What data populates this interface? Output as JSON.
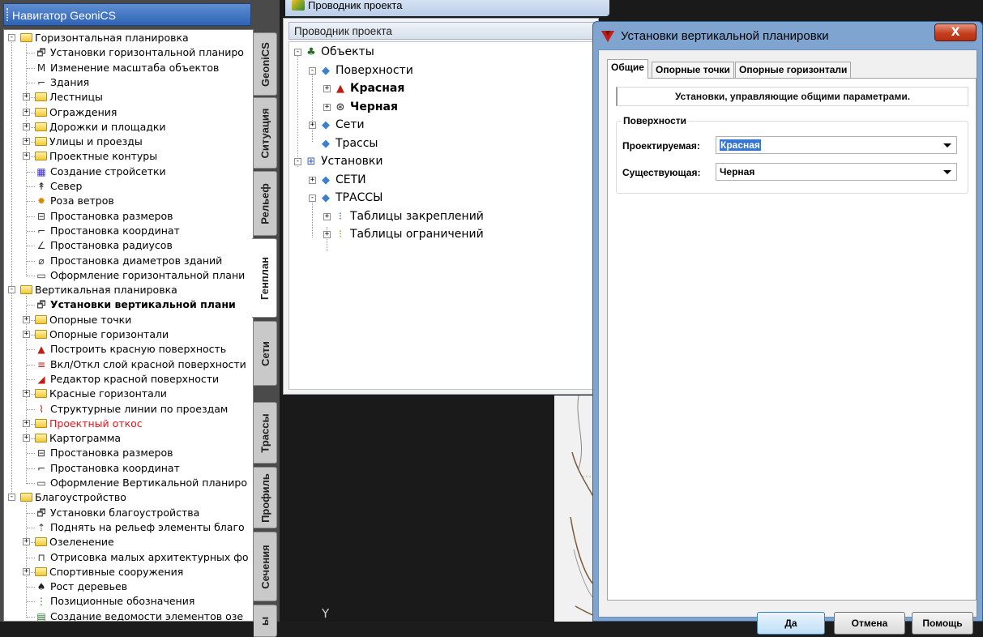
{
  "navigator": {
    "title": "Навигатор GeoniCS",
    "tabs": [
      "GeoniCS",
      "Ситуация",
      "Рельеф",
      "Генплан",
      "Сети",
      "Трассы",
      "Профиль",
      "Сечения",
      "ы"
    ],
    "active_tab": "Генплан",
    "tree": [
      {
        "label": "Горизонтальная планировка",
        "level": 0,
        "icon": "folder-open-icon",
        "expander": "-"
      },
      {
        "label": "Установки горизонтальной планиро",
        "level": 1,
        "icon": "settings-icon"
      },
      {
        "label": "Изменение масштаба объектов",
        "level": 1,
        "icon": "scale-icon"
      },
      {
        "label": "Здания",
        "level": 1,
        "icon": "building-icon"
      },
      {
        "label": "Лестницы",
        "level": 1,
        "icon": "folder-icon",
        "expander": "+"
      },
      {
        "label": "Ограждения",
        "level": 1,
        "icon": "folder-icon",
        "expander": "+"
      },
      {
        "label": "Дорожки и площадки",
        "level": 1,
        "icon": "folder-icon",
        "expander": "+"
      },
      {
        "label": "Улицы и проезды",
        "level": 1,
        "icon": "folder-icon",
        "expander": "+"
      },
      {
        "label": "Проектные контуры",
        "level": 1,
        "icon": "folder-icon",
        "expander": "+"
      },
      {
        "label": "Создание стройсетки",
        "level": 1,
        "icon": "grid-icon"
      },
      {
        "label": "Север",
        "level": 1,
        "icon": "north-icon"
      },
      {
        "label": "Роза ветров",
        "level": 1,
        "icon": "wind-rose-icon"
      },
      {
        "label": "Простановка размеров",
        "level": 1,
        "icon": "dimension-icon"
      },
      {
        "label": "Простановка координат",
        "level": 1,
        "icon": "coordinate-icon"
      },
      {
        "label": "Простановка радиусов",
        "level": 1,
        "icon": "radius-icon"
      },
      {
        "label": "Простановка диаметров зданий",
        "level": 1,
        "icon": "diameter-icon"
      },
      {
        "label": "Оформление горизонтальной плани",
        "level": 1,
        "icon": "document-icon"
      },
      {
        "label": "Вертикальная планировка",
        "level": 0,
        "icon": "folder-open-icon",
        "expander": "-"
      },
      {
        "label": "Установки вертикальной плани",
        "level": 1,
        "icon": "settings-icon",
        "bold": true
      },
      {
        "label": "Опорные точки",
        "level": 1,
        "icon": "folder-icon",
        "expander": "+"
      },
      {
        "label": "Опорные горизонтали",
        "level": 1,
        "icon": "folder-icon",
        "expander": "+"
      },
      {
        "label": "Построить красную поверхность",
        "level": 1,
        "icon": "red-surface-icon"
      },
      {
        "label": "Вкл/Откл слой красной поверхности",
        "level": 1,
        "icon": "layer-toggle-icon"
      },
      {
        "label": "Редактор красной поверхности",
        "level": 1,
        "icon": "surface-editor-icon"
      },
      {
        "label": "Красные горизонтали",
        "level": 1,
        "icon": "folder-icon",
        "expander": "+"
      },
      {
        "label": "Структурные линии по проездам",
        "level": 1,
        "icon": "structure-lines-icon"
      },
      {
        "label": "Проектный откос",
        "level": 1,
        "icon": "folder-icon",
        "expander": "+",
        "red": true
      },
      {
        "label": "Картограмма",
        "level": 1,
        "icon": "folder-icon",
        "expander": "+"
      },
      {
        "label": "Простановка размеров",
        "level": 1,
        "icon": "dimension-icon"
      },
      {
        "label": "Простановка координат",
        "level": 1,
        "icon": "coordinate-icon"
      },
      {
        "label": "Оформление Вертикальной планиро",
        "level": 1,
        "icon": "document-icon"
      },
      {
        "label": "Благоустройство",
        "level": 0,
        "icon": "folder-open-icon",
        "expander": "-"
      },
      {
        "label": "Установки благоустройства",
        "level": 1,
        "icon": "settings-icon"
      },
      {
        "label": "Поднять на рельеф элементы благо",
        "level": 1,
        "icon": "lift-icon"
      },
      {
        "label": "Озеленение",
        "level": 1,
        "icon": "folder-icon",
        "expander": "+"
      },
      {
        "label": "Отрисовка малых архитектурных фо",
        "level": 1,
        "icon": "bench-icon"
      },
      {
        "label": "Спортивные сооружения",
        "level": 1,
        "icon": "folder-icon",
        "expander": "+"
      },
      {
        "label": "Рост деревьев",
        "level": 1,
        "icon": "tree-growth-icon"
      },
      {
        "label": "Позиционные обозначения",
        "level": 1,
        "icon": "position-marks-icon"
      },
      {
        "label": "Создание ведомости элементов озе",
        "level": 1,
        "icon": "table-icon"
      }
    ]
  },
  "explorer": {
    "caption": "Проводник проекта",
    "header": "Проводник проекта",
    "tree": [
      {
        "label": "Объекты",
        "level": 0,
        "icon": "objects-icon",
        "expander": "-"
      },
      {
        "label": "Поверхности",
        "level": 1,
        "icon": "surfaces-icon",
        "expander": "-"
      },
      {
        "label": "Красная",
        "level": 2,
        "icon": "red-surface-icon",
        "expander": "+",
        "bold": true
      },
      {
        "label": "Черная",
        "level": 2,
        "icon": "black-surface-icon",
        "expander": "+",
        "bold": true
      },
      {
        "label": "Сети",
        "level": 1,
        "icon": "networks-icon",
        "expander": "+"
      },
      {
        "label": "Трассы",
        "level": 1,
        "icon": "routes-icon"
      },
      {
        "label": "Установки",
        "level": 0,
        "icon": "settings-tree-icon",
        "expander": "-"
      },
      {
        "label": "СЕТИ",
        "level": 1,
        "icon": "networks-icon",
        "expander": "+"
      },
      {
        "label": "ТРАССЫ",
        "level": 1,
        "icon": "routes-icon",
        "expander": "-"
      },
      {
        "label": "Таблицы закреплений",
        "level": 2,
        "icon": "fixings-table-icon",
        "expander": "+"
      },
      {
        "label": "Таблицы ограничений",
        "level": 2,
        "icon": "limits-table-icon",
        "expander": "+"
      }
    ]
  },
  "dialog": {
    "title": "Установки вертикальной планировки",
    "close": "X",
    "tabs": [
      "Общие",
      "Опорные точки",
      "Опорные горизонтали"
    ],
    "active_tab": "Общие",
    "info": "Установки, управляющие общими параметрами.",
    "group": "Поверхности",
    "design_label": "Проектируемая:",
    "design_value": "Красная",
    "existing_label": "Существующая:",
    "existing_value": "Черная",
    "buttons": {
      "ok": "Да",
      "cancel": "Отмена",
      "help": "Помощь"
    }
  },
  "canvas": {
    "axis_label": "Y"
  },
  "colors": {
    "title_blue": "#2e63b5",
    "highlight_red": "#e8161b",
    "selection": "#3476d2",
    "dialog_frame": "#7fa4cf"
  }
}
